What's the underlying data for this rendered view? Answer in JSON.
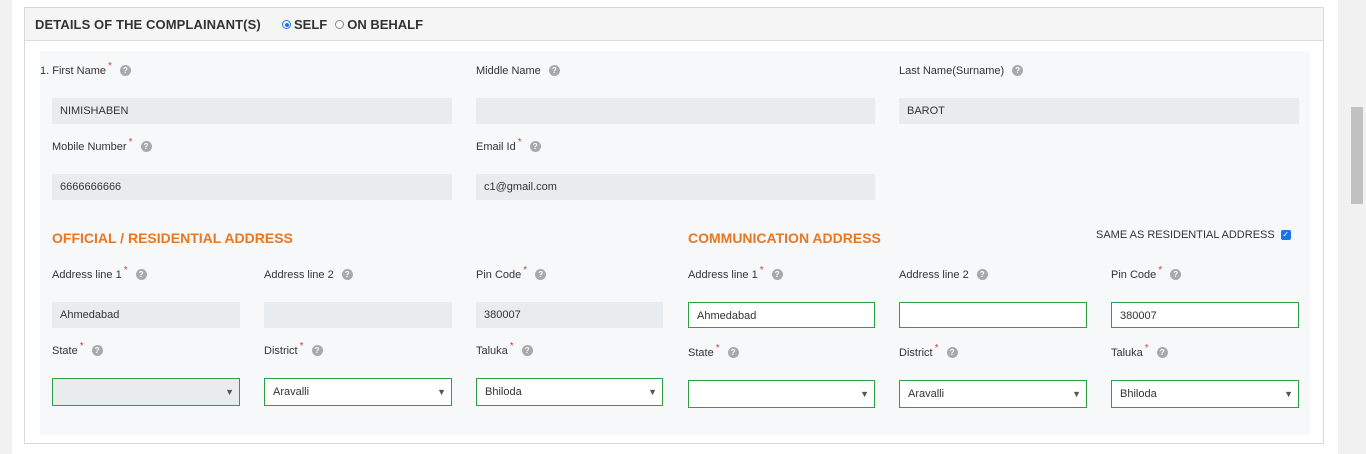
{
  "panel": {
    "title": "DETAILS OF THE COMPLAINANT(S)",
    "options": [
      {
        "label": "SELF",
        "checked": true
      },
      {
        "label": "ON BEHALF",
        "checked": false
      }
    ]
  },
  "personal": {
    "first_name_label": "1. First Name",
    "first_name_value": "NIMISHABEN",
    "middle_name_label": "Middle Name",
    "middle_name_value": "",
    "last_name_label": "Last Name(Surname)",
    "last_name_value": "BAROT",
    "mobile_label": "Mobile Number",
    "mobile_value": "6666666666",
    "email_label": "Email Id",
    "email_value": "c1@gmail.com"
  },
  "residential": {
    "title": "OFFICIAL / RESIDENTIAL ADDRESS",
    "address1_label": "Address line 1",
    "address1_value": "Ahmedabad",
    "address2_label": "Address line 2",
    "address2_value": "",
    "pin_label": "Pin Code",
    "pin_value": "380007",
    "state_label": "State",
    "state_value": "",
    "district_label": "District",
    "district_value": "Aravalli",
    "taluka_label": "Taluka",
    "taluka_value": "Bhiloda"
  },
  "communication": {
    "title": "COMMUNICATION ADDRESS",
    "same_as_label": "SAME AS RESIDENTIAL ADDRESS",
    "same_as_checked": true,
    "address1_label": "Address line 1",
    "address1_value": "Ahmedabad",
    "address2_label": "Address line 2",
    "address2_value": "",
    "pin_label": "Pin Code",
    "pin_value": "380007",
    "state_label": "State",
    "state_value": "",
    "district_label": "District",
    "district_value": "Aravalli",
    "taluka_label": "Taluka",
    "taluka_value": "Bhiloda"
  },
  "icons": {
    "required_marker": "*",
    "help": "?",
    "caret": "▼",
    "check": "✓"
  },
  "colors": {
    "accent_orange": "#e87722",
    "valid_green": "#2e9e46",
    "readonly_gray": "#e9ecef",
    "radio_blue": "#1a73e8"
  }
}
